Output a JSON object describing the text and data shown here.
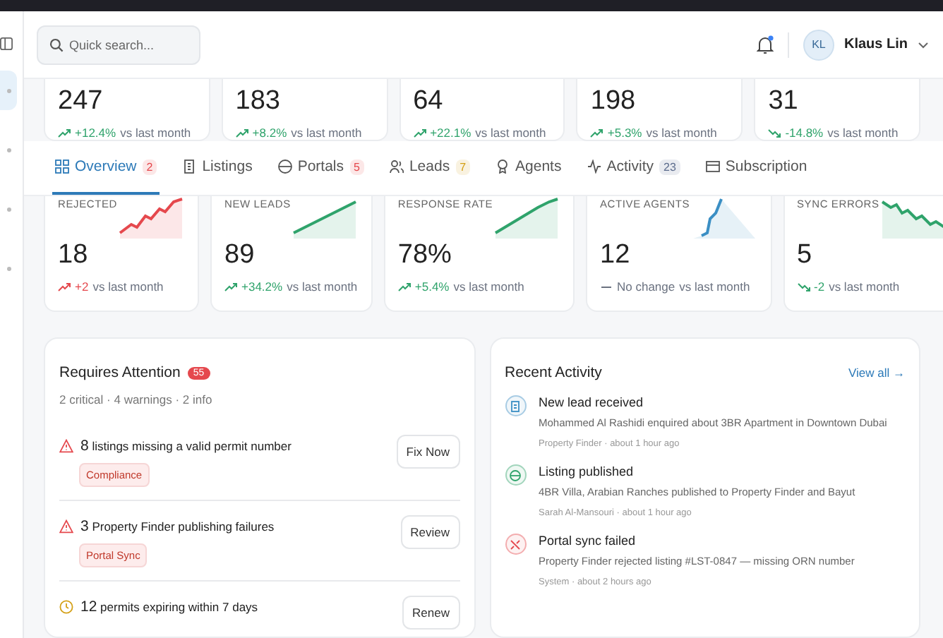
{
  "header": {
    "search": {
      "placeholder": "Quick search..."
    },
    "notifications": {
      "unread": true
    },
    "user": {
      "initials": "KL",
      "name": "Klaus Lin"
    }
  },
  "sidebar": {
    "items": [
      {
        "selected": true
      },
      {
        "selected": false
      },
      {
        "selected": false
      },
      {
        "selected": false
      }
    ]
  },
  "stats_top": [
    {
      "value": "247",
      "kind": "up",
      "change": {
        "text": "+12.4%",
        "color": "#2fa36b"
      },
      "suffix": "vs last month"
    },
    {
      "value": "183",
      "kind": "up",
      "change": {
        "text": "+8.2%",
        "color": "#2fa36b"
      },
      "suffix": "vs last month"
    },
    {
      "value": "64",
      "kind": "up",
      "change": {
        "text": "+22.1%",
        "color": "#2fa36b"
      },
      "suffix": "vs last month"
    },
    {
      "value": "198",
      "kind": "up",
      "change": {
        "text": "+5.3%",
        "color": "#2fa36b"
      },
      "suffix": "vs last month"
    },
    {
      "value": "31",
      "kind": "down",
      "change": {
        "text": "-14.8%",
        "color": "#2fa36b"
      },
      "suffix": "vs last month"
    }
  ],
  "tabs": [
    {
      "label": "Overview",
      "selected": true,
      "badge": {
        "text": "2",
        "color": "#e5484d"
      }
    },
    {
      "label": "Listings",
      "selected": false
    },
    {
      "label": "Portals",
      "selected": false,
      "badge": {
        "text": "5",
        "color": "#e5484d"
      }
    },
    {
      "label": "Leads",
      "selected": false,
      "badge": {
        "text": "7",
        "color": "#d4a017"
      }
    },
    {
      "label": "Agents",
      "selected": false
    },
    {
      "label": "Activity",
      "selected": false,
      "badge": {
        "text": "23",
        "color": "#5b6b8c"
      }
    },
    {
      "label": "Subscription",
      "selected": false
    }
  ],
  "stats": [
    {
      "label": "REJECTED",
      "value": "18",
      "kind": "up",
      "change": {
        "text": "+2",
        "color": "#e5484d"
      },
      "suffix": "vs last month",
      "color": "#e5484d"
    },
    {
      "label": "NEW LEADS",
      "value": "89",
      "kind": "up",
      "change": {
        "text": "+34.2%",
        "color": "#2fa36b"
      },
      "suffix": "vs last month",
      "color": "#2fa36b"
    },
    {
      "label": "RESPONSE RATE",
      "value": "78%",
      "kind": "up",
      "change": {
        "text": "+5.4%",
        "color": "#2fa36b"
      },
      "suffix": "vs last month",
      "color": "#2fa36b"
    },
    {
      "label": "ACTIVE AGENTS",
      "value": "12",
      "kind": "flat",
      "change": {
        "text": "No change",
        "color": "#6b7280"
      },
      "suffix": "vs last month",
      "color": "#3b8fc4"
    },
    {
      "label": "SYNC ERRORS",
      "value": "5",
      "kind": "down",
      "change": {
        "text": "-2",
        "color": "#2fa36b"
      },
      "suffix": "vs last month",
      "color": "#2fa36b"
    }
  ],
  "attention": {
    "title": "Requires Attention",
    "badge": "55",
    "summary": "2 critical · 4 warnings · 2 info",
    "items": [
      {
        "kind": "critical",
        "count": "8",
        "text": "listings missing a valid permit number",
        "tag": "Compliance",
        "action": "Fix Now"
      },
      {
        "kind": "critical",
        "count": "3",
        "text": "Property Finder publishing failures",
        "tag": "Portal Sync",
        "action": "Review"
      },
      {
        "kind": "warning",
        "count": "12",
        "text": "permits expiring within 7 days",
        "action": "Renew"
      }
    ]
  },
  "activity": {
    "title": "Recent Activity",
    "link": "View all →",
    "items": [
      {
        "kind": "lead",
        "title": "New lead received",
        "description": "Mohammed Al Rashidi enquired about 3BR Apartment in Downtown Dubai",
        "meta": "Property Finder · about 1 hour ago"
      },
      {
        "kind": "listing",
        "title": "Listing published",
        "description": "4BR Villa, Arabian Ranches published to Property Finder and Bayut",
        "meta": "Sarah Al-Mansouri · about 1 hour ago"
      },
      {
        "kind": "error",
        "title": "Portal sync failed",
        "description": "Property Finder rejected listing #LST-0847 — missing ORN number",
        "meta": "System · about 2 hours ago"
      }
    ]
  }
}
